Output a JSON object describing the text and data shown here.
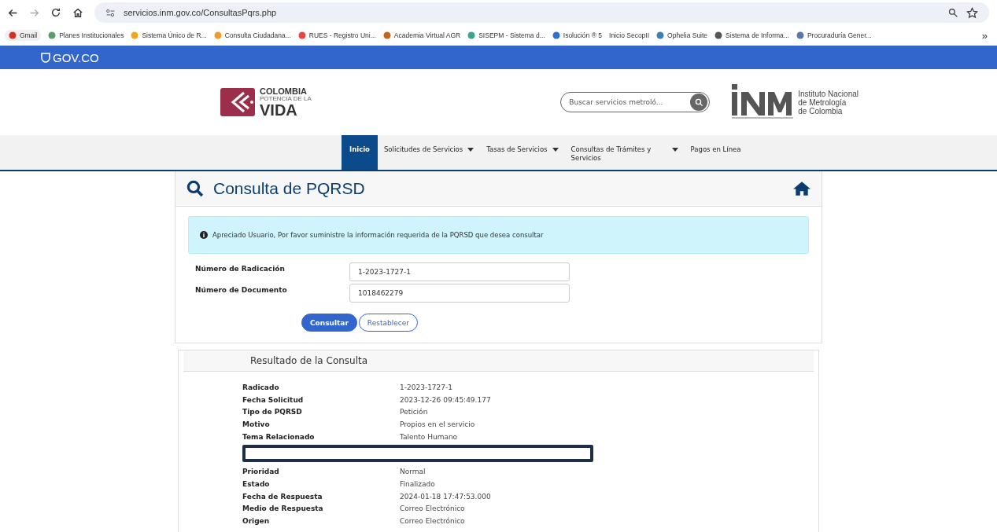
{
  "browser": {
    "url": "servicios.inm.gov.co/ConsultasPqrs.php",
    "bookmarks": [
      {
        "label": "Gmail",
        "has_icon": true
      },
      {
        "label": "Planes Institucionales",
        "has_icon": true
      },
      {
        "label": "Sistema Único de R...",
        "has_icon": true
      },
      {
        "label": "Consulta Ciudadana...",
        "has_icon": true
      },
      {
        "label": "RUES - Registro Uni...",
        "has_icon": true
      },
      {
        "label": "Academia Virtual AGR",
        "has_icon": true
      },
      {
        "label": "SISEPM - Sistema d...",
        "has_icon": true
      },
      {
        "label": "Isolución ® 5",
        "has_icon": true
      },
      {
        "label": "Inicio SecopII",
        "has_icon": false
      },
      {
        "label": "Ophelia Suite",
        "has_icon": true
      },
      {
        "label": "Sistema de Informa...",
        "has_icon": true
      },
      {
        "label": "Procuraduría Gener...",
        "has_icon": true
      }
    ],
    "more": "»"
  },
  "gov_bar": {
    "brand": "GOV.CO"
  },
  "header": {
    "logo_lines": [
      "COLOMBIA",
      "POTENCIA DE LA",
      "VIDA"
    ],
    "search": {
      "placeholder": "Buscar servicios metroló..."
    },
    "inm_lines": [
      "Instituto Nacional",
      "de Metrología",
      "de Colombia"
    ]
  },
  "nav": [
    {
      "label": "Inicio",
      "selected": true,
      "dropdown": false
    },
    {
      "label": "Solicitudes de Servicios",
      "selected": false,
      "dropdown": true
    },
    {
      "label": "Tasas de Servicios",
      "selected": false,
      "dropdown": true
    },
    {
      "label": "Consultas de Trámites y Servicios",
      "selected": false,
      "dropdown": true
    },
    {
      "label": "Pagos en Línea",
      "selected": false,
      "dropdown": false
    }
  ],
  "page": {
    "title": "Consulta de PQRSD",
    "alert": "Apreciado Usuario, Por favor suministre la información requerida de la PQRSD que desea consultar",
    "fields": [
      {
        "label": "Número de Radicación",
        "value": "1-2023-1727-1"
      },
      {
        "label": "Número de Documento",
        "value": "1018462279"
      }
    ],
    "buttons": [
      {
        "label": "Consultar",
        "kind": "primary"
      },
      {
        "label": "Restablecer",
        "kind": "outline"
      }
    ]
  },
  "result": {
    "title": "Resultado de la Consulta",
    "rows": [
      {
        "label": "Radicado",
        "value": "1-2023-1727-1",
        "kind": "row"
      },
      {
        "label": "Fecha Solicitud",
        "value": "2023-12-26 09:45:49.177",
        "kind": "row"
      },
      {
        "label": "Tipo de PQRSD",
        "value": "Petición",
        "kind": "row"
      },
      {
        "label": "Motivo",
        "value": "Propios en el servicio",
        "kind": "row"
      },
      {
        "label": "Tema Relacionado",
        "value": "Talento Humano",
        "kind": "row"
      },
      {
        "kind": "redacted"
      },
      {
        "label": "Prioridad",
        "value": "Normal",
        "kind": "row"
      },
      {
        "label": "Estado",
        "value": "Finalizado",
        "kind": "row"
      },
      {
        "label": "Fecha de Respuesta",
        "value": "2024-01-18 17:47:53.000",
        "kind": "row"
      },
      {
        "label": "Medio de Respuesta",
        "value": "Correo Electrónico",
        "kind": "row"
      },
      {
        "label": "Origen",
        "value": "Correo Electrónico",
        "kind": "row"
      }
    ]
  }
}
